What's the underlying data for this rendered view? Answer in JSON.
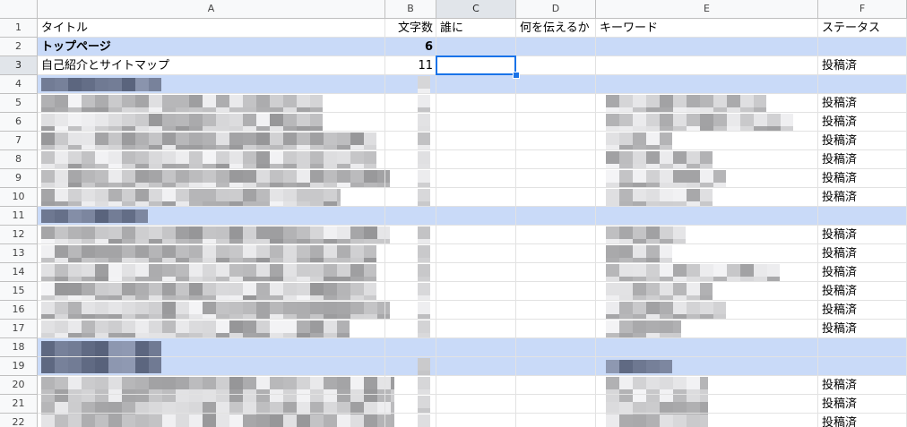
{
  "columns": [
    {
      "letter": "A",
      "selected": false
    },
    {
      "letter": "B",
      "selected": false
    },
    {
      "letter": "C",
      "selected": true
    },
    {
      "letter": "D",
      "selected": false
    },
    {
      "letter": "E",
      "selected": false
    },
    {
      "letter": "F",
      "selected": false
    }
  ],
  "rows": [
    {
      "num": "1",
      "selected": false,
      "type": "header",
      "cells": {
        "A": "タイトル",
        "B": "文字数",
        "C": "誰に",
        "D": "何を伝えるか",
        "E": "キーワード",
        "F": "ステータス"
      }
    },
    {
      "num": "2",
      "selected": false,
      "type": "section",
      "cells": {
        "A": "トップページ",
        "B": "6"
      }
    },
    {
      "num": "3",
      "selected": true,
      "type": "data",
      "cells": {
        "A": "自己紹介とサイトマップ",
        "B": "11",
        "F": "投稿済"
      }
    },
    {
      "num": "4",
      "selected": false,
      "type": "section",
      "cells": {}
    },
    {
      "num": "5",
      "selected": false,
      "type": "data",
      "cells": {
        "F": "投稿済"
      }
    },
    {
      "num": "6",
      "selected": false,
      "type": "data",
      "cells": {
        "F": "投稿済"
      }
    },
    {
      "num": "7",
      "selected": false,
      "type": "data",
      "cells": {
        "F": "投稿済"
      }
    },
    {
      "num": "8",
      "selected": false,
      "type": "data",
      "cells": {
        "F": "投稿済"
      }
    },
    {
      "num": "9",
      "selected": false,
      "type": "data",
      "cells": {
        "F": "投稿済"
      }
    },
    {
      "num": "10",
      "selected": false,
      "type": "data",
      "cells": {
        "F": "投稿済"
      }
    },
    {
      "num": "11",
      "selected": false,
      "type": "section",
      "cells": {}
    },
    {
      "num": "12",
      "selected": false,
      "type": "data",
      "cells": {
        "F": "投稿済"
      }
    },
    {
      "num": "13",
      "selected": false,
      "type": "data",
      "cells": {
        "F": "投稿済"
      }
    },
    {
      "num": "14",
      "selected": false,
      "type": "data",
      "cells": {
        "F": "投稿済"
      }
    },
    {
      "num": "15",
      "selected": false,
      "type": "data",
      "cells": {
        "F": "投稿済"
      }
    },
    {
      "num": "16",
      "selected": false,
      "type": "data",
      "cells": {
        "F": "投稿済"
      }
    },
    {
      "num": "17",
      "selected": false,
      "type": "data",
      "cells": {
        "F": "投稿済"
      }
    },
    {
      "num": "18",
      "selected": false,
      "type": "section",
      "cells": {}
    },
    {
      "num": "19",
      "selected": false,
      "type": "section",
      "cells": {}
    },
    {
      "num": "20",
      "selected": false,
      "type": "data",
      "cells": {
        "F": "投稿済"
      }
    },
    {
      "num": "21",
      "selected": false,
      "type": "data",
      "cells": {
        "F": "投稿済"
      }
    },
    {
      "num": "22",
      "selected": false,
      "type": "data",
      "cells": {
        "F": "投稿済"
      }
    }
  ],
  "active_cell": "C3",
  "colors": {
    "section_fill": "#c9daf8",
    "selection_border": "#1a73e8",
    "header_fill": "#f8f9fa",
    "selected_header_fill": "#e1e5ea"
  }
}
